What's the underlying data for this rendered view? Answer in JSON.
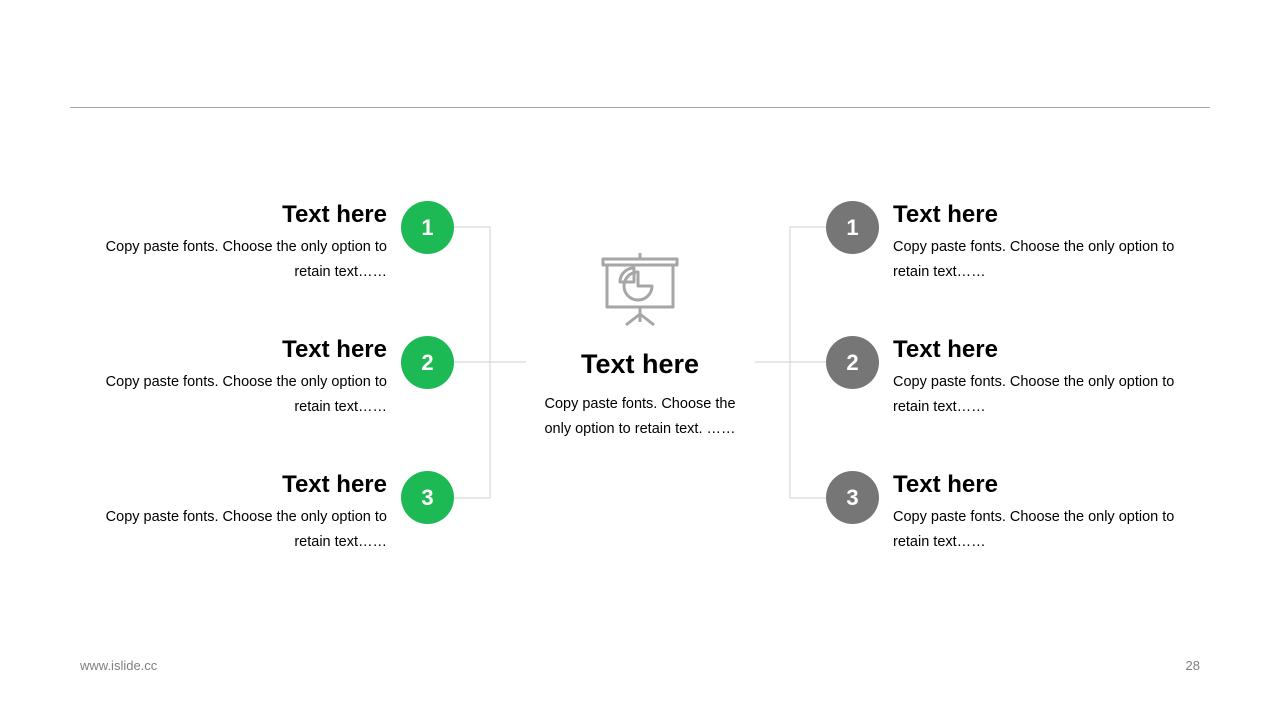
{
  "colors": {
    "green": "#1db954",
    "gray": "#767676",
    "rule": "#a6a6a6",
    "connector": "#d0d0d0",
    "icon": "#a6a6a6"
  },
  "center": {
    "icon": "presentation-pie-chart-icon",
    "title": "Text here",
    "description": "Copy paste fonts. Choose the only option to retain text. ……"
  },
  "left_items": [
    {
      "number": "1",
      "title": "Text here",
      "description": "Copy paste fonts. Choose the only option to retain text……"
    },
    {
      "number": "2",
      "title": "Text here",
      "description": "Copy paste fonts. Choose the only option to retain text……"
    },
    {
      "number": "3",
      "title": "Text here",
      "description": "Copy paste fonts. Choose the only option to retain text……"
    }
  ],
  "right_items": [
    {
      "number": "1",
      "title": "Text here",
      "description": "Copy paste fonts. Choose the only option to retain text……"
    },
    {
      "number": "2",
      "title": "Text here",
      "description": "Copy paste fonts. Choose the only option to retain text……"
    },
    {
      "number": "3",
      "title": "Text here",
      "description": "Copy paste fonts. Choose the only option to retain text……"
    }
  ],
  "footer": {
    "url": "www.islide.cc",
    "page_number": "28"
  }
}
